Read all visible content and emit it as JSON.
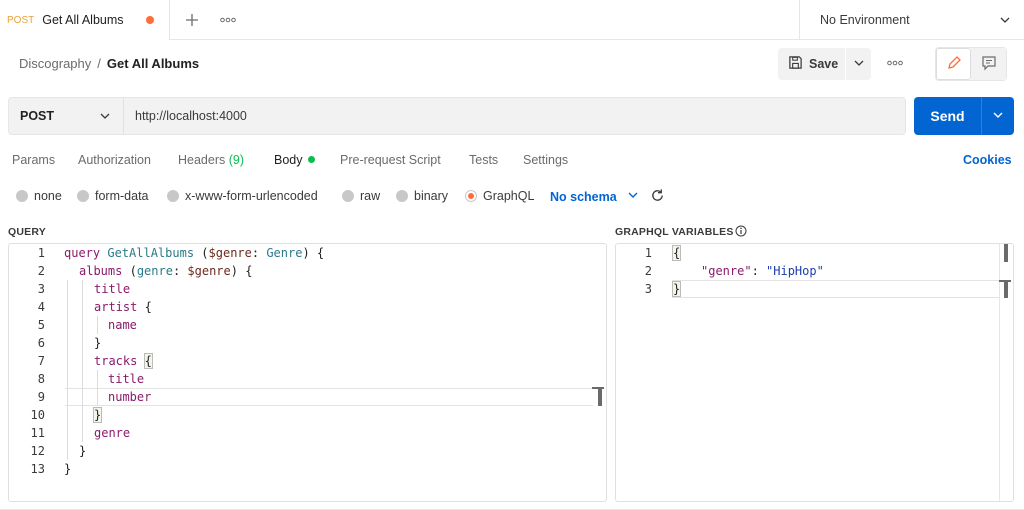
{
  "tab": {
    "method": "POST",
    "title": "Get All Albums",
    "unsaved": true
  },
  "tabbar": {
    "new_tab_icon": "plus-icon",
    "more_icon": "ellipsis-icon"
  },
  "environment": {
    "label": "No Environment"
  },
  "breadcrumb": {
    "parent": "Discography",
    "separator": "/",
    "current": "Get All Albums"
  },
  "toolbar": {
    "save_label": "Save"
  },
  "request": {
    "method": "POST",
    "url": "http://localhost:4000",
    "send_label": "Send"
  },
  "request_tabs": {
    "params": "Params",
    "authorization": "Authorization",
    "headers": "Headers",
    "headers_count": "(9)",
    "body": "Body",
    "pre_request": "Pre-request Script",
    "tests": "Tests",
    "settings": "Settings",
    "cookies": "Cookies"
  },
  "body_types": {
    "none": "none",
    "form_data": "form-data",
    "urlencoded": "x-www-form-urlencoded",
    "raw": "raw",
    "binary": "binary",
    "graphql": "GraphQL",
    "selected": "GraphQL",
    "schema": "No schema"
  },
  "query_panel": {
    "label": "QUERY",
    "line_numbers": [
      "1",
      "2",
      "3",
      "4",
      "5",
      "6",
      "7",
      "8",
      "9",
      "10",
      "11",
      "12",
      "13"
    ]
  },
  "variables_panel": {
    "label": "GRAPHQL VARIABLES",
    "line_numbers": [
      "1",
      "2",
      "3"
    ]
  },
  "query_code": {
    "l1_kw": "query",
    "l1_name": "GetAllAlbums",
    "l1_open": " (",
    "l1_var": "$genre",
    "l1_colon": ": ",
    "l1_type": "Genre",
    "l1_close": ") {",
    "l2_field": "albums",
    "l2_open": " (",
    "l2_arg": "genre",
    "l2_colon": ": ",
    "l2_var": "$genre",
    "l2_close": ") {",
    "l3": "title",
    "l4": "artist",
    "l4_brace": " {",
    "l5": "name",
    "l6": "}",
    "l7": "tracks",
    "l7_brace": "{",
    "l8": "title",
    "l9": "number",
    "l10": "}",
    "l11": "genre",
    "l12": "}",
    "l13": "}"
  },
  "variables_code": {
    "l1": "{",
    "l2_key": "\"genre\"",
    "l2_colon": ": ",
    "l2_value": "\"HipHop\"",
    "l3": "}"
  }
}
